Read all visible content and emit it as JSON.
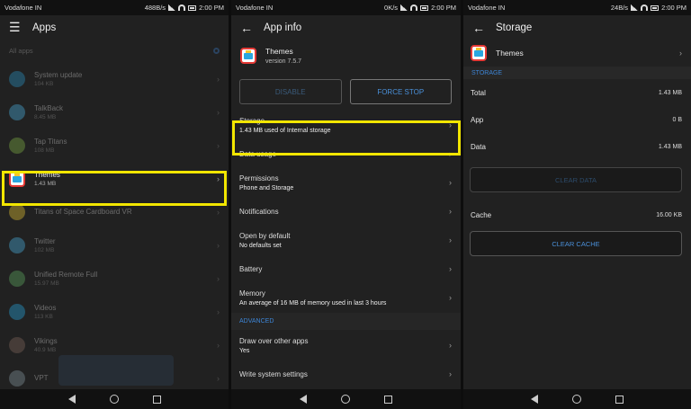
{
  "left_panel": {
    "status": {
      "carrier": "Vodafone IN",
      "right": "488B/s",
      "time": "2:00 PM"
    },
    "title": "Apps",
    "all_apps_label": "All apps",
    "apps": [
      {
        "name": "System update",
        "size": "104 KB",
        "color": "#2a9fd6",
        "dim": true
      },
      {
        "name": "TalkBack",
        "size": "8.45 MB",
        "color": "#4fc3f7",
        "dim": true
      },
      {
        "name": "Tap Titans",
        "size": "108 MB",
        "color": "#8bc34a",
        "dim": true
      },
      {
        "name": "Themes",
        "size": "1.43 MB",
        "color": "",
        "dim": false
      },
      {
        "name": "Titans of Space Cardboard VR",
        "size": "",
        "color": "#fdd835",
        "dim": true
      },
      {
        "name": "Twitter",
        "size": "102 MB",
        "color": "#4fc3f7",
        "dim": true
      },
      {
        "name": "Unified Remote Full",
        "size": "15.97 MB",
        "color": "#66bb6a",
        "dim": true
      },
      {
        "name": "Videos",
        "size": "113 KB",
        "color": "#29b6f6",
        "dim": true
      },
      {
        "name": "Vikings",
        "size": "40.9 MB",
        "color": "#8d6e63",
        "dim": true
      },
      {
        "name": "VPT",
        "size": "",
        "color": "#90a4ae",
        "dim": true
      }
    ]
  },
  "middle_panel": {
    "status": {
      "carrier": "Vodafone IN",
      "right": "0K/s",
      "time": "2:00 PM"
    },
    "title": "App info",
    "app_name": "Themes",
    "app_version": "version 7.5.7",
    "disable_label": "DISABLE",
    "force_stop_label": "FORCE STOP",
    "rows": [
      {
        "title": "Storage",
        "sub": "1.43 MB used of Internal storage"
      },
      {
        "title": "Data usage",
        "sub": ""
      },
      {
        "title": "Permissions",
        "sub": "Phone and Storage"
      },
      {
        "title": "Notifications",
        "sub": ""
      },
      {
        "title": "Open by default",
        "sub": "No defaults set"
      },
      {
        "title": "Battery",
        "sub": ""
      },
      {
        "title": "Memory",
        "sub": "An average of 16 MB of memory used in last 3 hours"
      }
    ],
    "advanced_label": "ADVANCED",
    "adv_rows": [
      {
        "title": "Draw over other apps",
        "sub": "Yes"
      },
      {
        "title": "Write system settings",
        "sub": ""
      }
    ]
  },
  "right_panel": {
    "status": {
      "carrier": "Vodafone IN",
      "right": "24B/s",
      "time": "2:00 PM"
    },
    "title": "Storage",
    "app_name": "Themes",
    "section_label": "STORAGE",
    "total_label": "Total",
    "total_value": "1.43 MB",
    "app_label": "App",
    "app_value": "0 B",
    "data_label": "Data",
    "data_value": "1.43 MB",
    "clear_data_label": "CLEAR DATA",
    "cache_label": "Cache",
    "cache_value": "16.00 KB",
    "clear_cache_label": "CLEAR CACHE"
  }
}
